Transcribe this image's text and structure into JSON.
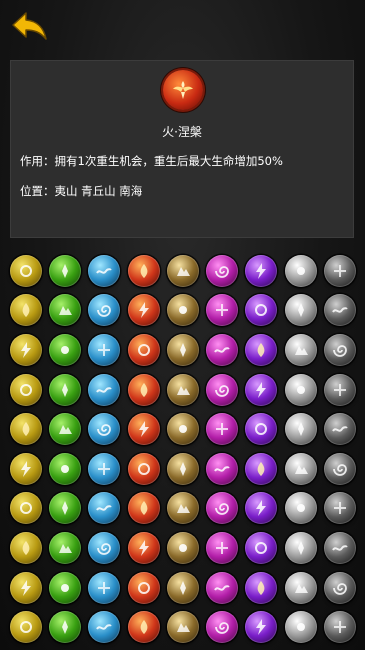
{
  "header": {
    "back_icon": "back-arrow-icon",
    "accent_color": "#f2b705"
  },
  "skill_detail": {
    "emblem_icon": "phoenix-icon",
    "name": "火·涅槃",
    "effect_text": "作用：拥有1次重生机会，重生后最大生命增加50%",
    "location_text": "位置：夷山 青丘山 南海"
  },
  "grid": {
    "element_colors": [
      "gold",
      "green",
      "blue",
      "red",
      "earth",
      "magenta",
      "purple",
      "white",
      "gray"
    ],
    "rows": [
      [
        "hammer-icon",
        "leaf-icon",
        "wave-icon",
        "flame-icon",
        "rock-icon",
        "vortex-icon",
        "lightning-icon",
        "light-orb-icon",
        "spiral-icon"
      ],
      [
        "shield-icon",
        "vine-icon",
        "water-ring-icon",
        "fire-ring-icon",
        "quake-icon",
        "whirl-icon",
        "bolt-icon",
        "star-icon",
        "orb-icon"
      ],
      [
        "spear-icon",
        "thorn-icon",
        "droplet-icon",
        "fire-burst-icon",
        "boulder-icon",
        "tornado-icon",
        "storm-icon",
        "glow-icon",
        "shadow-icon"
      ],
      [
        "sword-icon",
        "branch-icon",
        "tide-icon",
        "blaze-icon",
        "sand-icon",
        "wind-icon",
        "thunder-icon",
        "cross-icon",
        "skull-icon"
      ],
      [
        "blade-icon",
        "arrow-icon",
        "bubble-icon",
        "figure-icon",
        "mountain-icon",
        "fan-icon",
        "lightning-icon",
        "clock-icon",
        "void-icon"
      ],
      [
        "claw-icon",
        "forest-icon",
        "splash-icon",
        "crack-icon",
        "guard-icon",
        "cyclone-icon",
        "spark-icon",
        "beam-icon",
        "mist-icon"
      ],
      [
        "armor-icon",
        "mushroom-icon",
        "ice-icon",
        "ember-icon",
        "golem-icon",
        "dash-icon",
        "surge-icon",
        "sphere-icon",
        "dark-icon"
      ],
      [
        "coil-icon",
        "bloom-icon",
        "river-icon",
        "lava-icon",
        "terrain-icon",
        "gust-icon",
        "charge-icon",
        "pyramid-icon",
        "eye-icon"
      ],
      [
        "rune-icon",
        "sprout-icon",
        "current-icon",
        "inferno-icon",
        "stone-icon",
        "square-icon",
        "pulse-icon",
        "halo-icon",
        "ring-icon"
      ],
      [
        "totem-icon",
        "grass-icon",
        "ocean-icon",
        "demon-icon",
        "cliff-icon",
        "twister-icon",
        "arc-icon",
        "shine-icon",
        "shade-icon"
      ]
    ]
  }
}
